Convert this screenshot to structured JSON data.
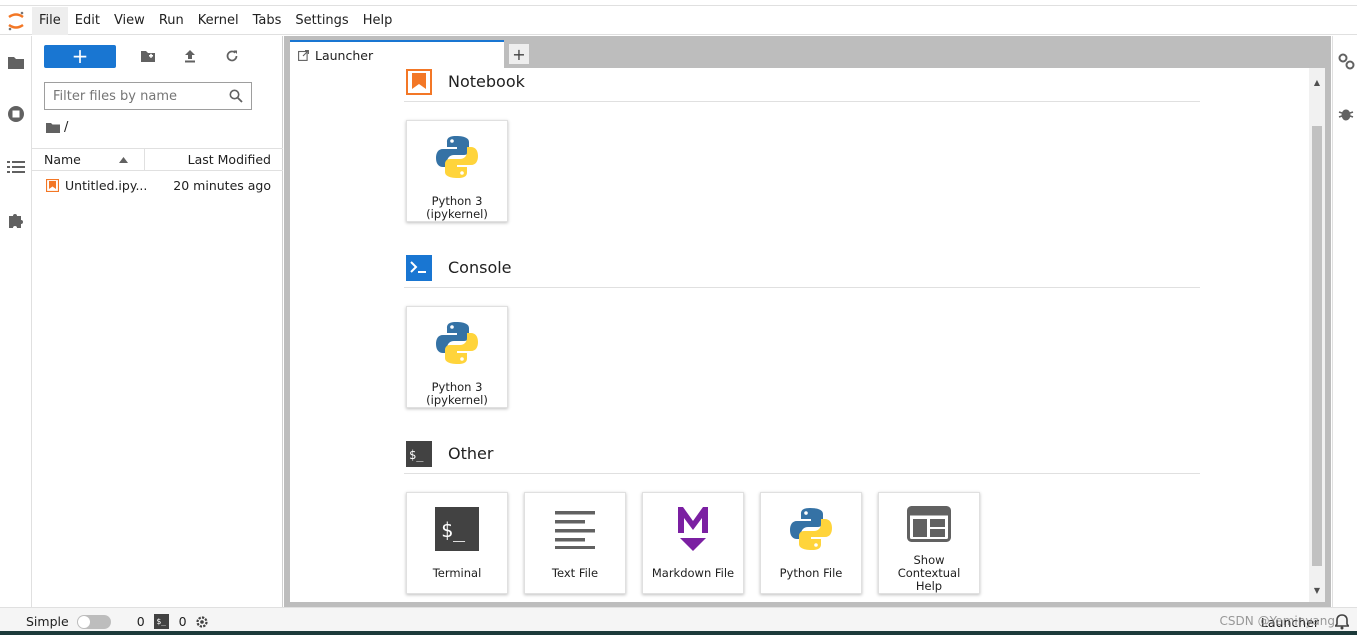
{
  "menubar": {
    "items": [
      "File",
      "Edit",
      "View",
      "Run",
      "Kernel",
      "Tabs",
      "Settings",
      "Help"
    ]
  },
  "activity_bar": {
    "icons": [
      "folder-icon",
      "running-icon",
      "toc-icon",
      "extension-icon"
    ]
  },
  "filebrowser": {
    "new_label": "+",
    "filter_placeholder": "Filter files by name",
    "breadcrumb": "/",
    "columns": {
      "name": "Name",
      "modified": "Last Modified"
    },
    "files": [
      {
        "name": "Untitled.ipy...",
        "modified": "20 minutes ago"
      }
    ]
  },
  "tabs": [
    {
      "label": "Launcher"
    }
  ],
  "launcher": {
    "sections": [
      {
        "title": "Notebook",
        "items": [
          {
            "label": "Python 3 (ipykernel)"
          }
        ]
      },
      {
        "title": "Console",
        "items": [
          {
            "label": "Python 3 (ipykernel)"
          }
        ]
      },
      {
        "title": "Other",
        "items": [
          {
            "label": "Terminal"
          },
          {
            "label": "Text File"
          },
          {
            "label": "Markdown File"
          },
          {
            "label": "Python File"
          },
          {
            "label": "Show Contextual Help"
          }
        ]
      }
    ]
  },
  "statusbar": {
    "mode_label": "Simple",
    "terminals_count": "0",
    "kernels_count": "0",
    "active_tab": "Launcher",
    "watermark": "CSDN @Yeminyang",
    "badge_text": "$_"
  },
  "colors": {
    "accent": "#1976d2",
    "notebook_orange": "#f37726",
    "markdown_purple": "#7b1fa2"
  }
}
